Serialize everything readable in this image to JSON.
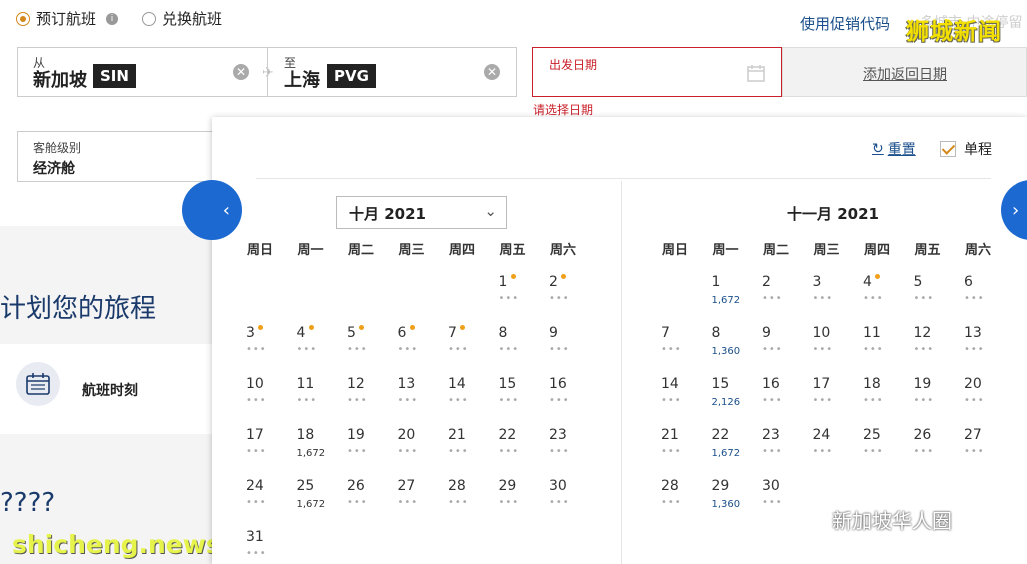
{
  "top": {
    "radio_book": "预订航班",
    "radio_redeem": "兑换航班",
    "promo": "使用促销代码",
    "watermark_top": "狮城新闻",
    "watermark_top_sub": "多城市 中途停留"
  },
  "route": {
    "from_label": "从",
    "from_city": "新加坡",
    "from_code": "SIN",
    "to_label": "至",
    "to_city": "上海",
    "to_code": "PVG"
  },
  "date": {
    "label": "出发日期",
    "error": "请选择日期",
    "add_return": "添加返回日期"
  },
  "cabin": {
    "label": "客舱级别",
    "value": "经济舱"
  },
  "left": {
    "plan_title": "计划您的旅程",
    "schedule": "航班时刻",
    "qmarks": "????",
    "watermark": "shicheng.news"
  },
  "calendar": {
    "reset": "重置",
    "one_way": "单程",
    "left_month": "十月 2021",
    "right_month": "十一月 2021",
    "weekdays": [
      "周日",
      "周一",
      "周二",
      "周三",
      "周四",
      "周五",
      "周六"
    ],
    "left_days": [
      {
        "d": "1",
        "col": 5,
        "row": 0,
        "dot": true
      },
      {
        "d": "2",
        "col": 6,
        "row": 0,
        "dot": true
      },
      {
        "d": "3",
        "col": 0,
        "row": 1,
        "dot": true
      },
      {
        "d": "4",
        "col": 1,
        "row": 1,
        "dot": true
      },
      {
        "d": "5",
        "col": 2,
        "row": 1,
        "dot": true
      },
      {
        "d": "6",
        "col": 3,
        "row": 1,
        "dot": true
      },
      {
        "d": "7",
        "col": 4,
        "row": 1,
        "dot": true
      },
      {
        "d": "8",
        "col": 5,
        "row": 1
      },
      {
        "d": "9",
        "col": 6,
        "row": 1
      },
      {
        "d": "10",
        "col": 0,
        "row": 2
      },
      {
        "d": "11",
        "col": 1,
        "row": 2
      },
      {
        "d": "12",
        "col": 2,
        "row": 2
      },
      {
        "d": "13",
        "col": 3,
        "row": 2
      },
      {
        "d": "14",
        "col": 4,
        "row": 2
      },
      {
        "d": "15",
        "col": 5,
        "row": 2
      },
      {
        "d": "16",
        "col": 6,
        "row": 2
      },
      {
        "d": "17",
        "col": 0,
        "row": 3
      },
      {
        "d": "18",
        "col": 1,
        "row": 3,
        "price": "1,672"
      },
      {
        "d": "19",
        "col": 2,
        "row": 3
      },
      {
        "d": "20",
        "col": 3,
        "row": 3
      },
      {
        "d": "21",
        "col": 4,
        "row": 3
      },
      {
        "d": "22",
        "col": 5,
        "row": 3
      },
      {
        "d": "23",
        "col": 6,
        "row": 3
      },
      {
        "d": "24",
        "col": 0,
        "row": 4
      },
      {
        "d": "25",
        "col": 1,
        "row": 4,
        "price": "1,672"
      },
      {
        "d": "26",
        "col": 2,
        "row": 4
      },
      {
        "d": "27",
        "col": 3,
        "row": 4
      },
      {
        "d": "28",
        "col": 4,
        "row": 4
      },
      {
        "d": "29",
        "col": 5,
        "row": 4
      },
      {
        "d": "30",
        "col": 6,
        "row": 4
      },
      {
        "d": "31",
        "col": 0,
        "row": 5
      }
    ],
    "right_days": [
      {
        "d": "1",
        "col": 1,
        "row": 0,
        "price": "1,672",
        "blue": true
      },
      {
        "d": "2",
        "col": 2,
        "row": 0
      },
      {
        "d": "3",
        "col": 3,
        "row": 0
      },
      {
        "d": "4",
        "col": 4,
        "row": 0,
        "dot": true
      },
      {
        "d": "5",
        "col": 5,
        "row": 0
      },
      {
        "d": "6",
        "col": 6,
        "row": 0
      },
      {
        "d": "7",
        "col": 0,
        "row": 1
      },
      {
        "d": "8",
        "col": 1,
        "row": 1,
        "price": "1,360",
        "blue": true
      },
      {
        "d": "9",
        "col": 2,
        "row": 1
      },
      {
        "d": "10",
        "col": 3,
        "row": 1
      },
      {
        "d": "11",
        "col": 4,
        "row": 1
      },
      {
        "d": "12",
        "col": 5,
        "row": 1
      },
      {
        "d": "13",
        "col": 6,
        "row": 1
      },
      {
        "d": "14",
        "col": 0,
        "row": 2
      },
      {
        "d": "15",
        "col": 1,
        "row": 2,
        "price": "2,126",
        "blue": true
      },
      {
        "d": "16",
        "col": 2,
        "row": 2
      },
      {
        "d": "17",
        "col": 3,
        "row": 2
      },
      {
        "d": "18",
        "col": 4,
        "row": 2
      },
      {
        "d": "19",
        "col": 5,
        "row": 2
      },
      {
        "d": "20",
        "col": 6,
        "row": 2
      },
      {
        "d": "21",
        "col": 0,
        "row": 3
      },
      {
        "d": "22",
        "col": 1,
        "row": 3,
        "price": "1,672",
        "blue": true
      },
      {
        "d": "23",
        "col": 2,
        "row": 3
      },
      {
        "d": "24",
        "col": 3,
        "row": 3
      },
      {
        "d": "25",
        "col": 4,
        "row": 3
      },
      {
        "d": "26",
        "col": 5,
        "row": 3
      },
      {
        "d": "27",
        "col": 6,
        "row": 3
      },
      {
        "d": "28",
        "col": 0,
        "row": 4
      },
      {
        "d": "29",
        "col": 1,
        "row": 4,
        "price": "1,360",
        "blue": true
      },
      {
        "d": "30",
        "col": 2,
        "row": 4
      }
    ]
  },
  "wechat_mark": "新加坡华人圈"
}
